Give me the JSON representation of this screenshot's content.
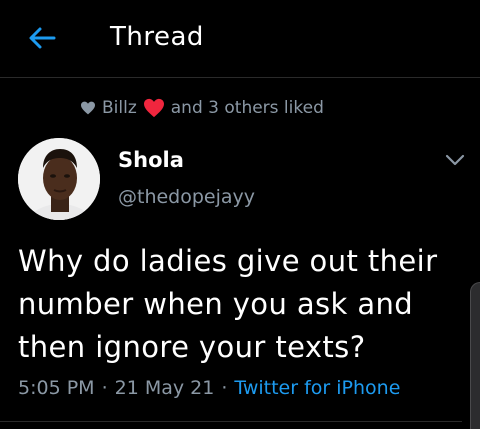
{
  "header": {
    "title": "Thread",
    "back_icon": "arrow-left-icon",
    "accent_color": "#1d9bf0"
  },
  "social_context": {
    "liker": "Billz",
    "rest": "and 3 others liked",
    "icon": "heart-icon",
    "emoji_icon": "red-heart-emoji-icon"
  },
  "tweet": {
    "author_name": "Shola",
    "author_handle": "@thedopejayy",
    "text": "Why do ladies give out their number when you ask and then ignore your texts?",
    "time": "5:05 PM",
    "date": "21 May 21",
    "separator": "·",
    "source": "Twitter for iPhone",
    "more_icon": "chevron-down-icon"
  },
  "colors": {
    "background": "#000000",
    "secondary_text": "#8b98a5",
    "link": "#1d9bf0",
    "heart_red": "#f0263e"
  }
}
